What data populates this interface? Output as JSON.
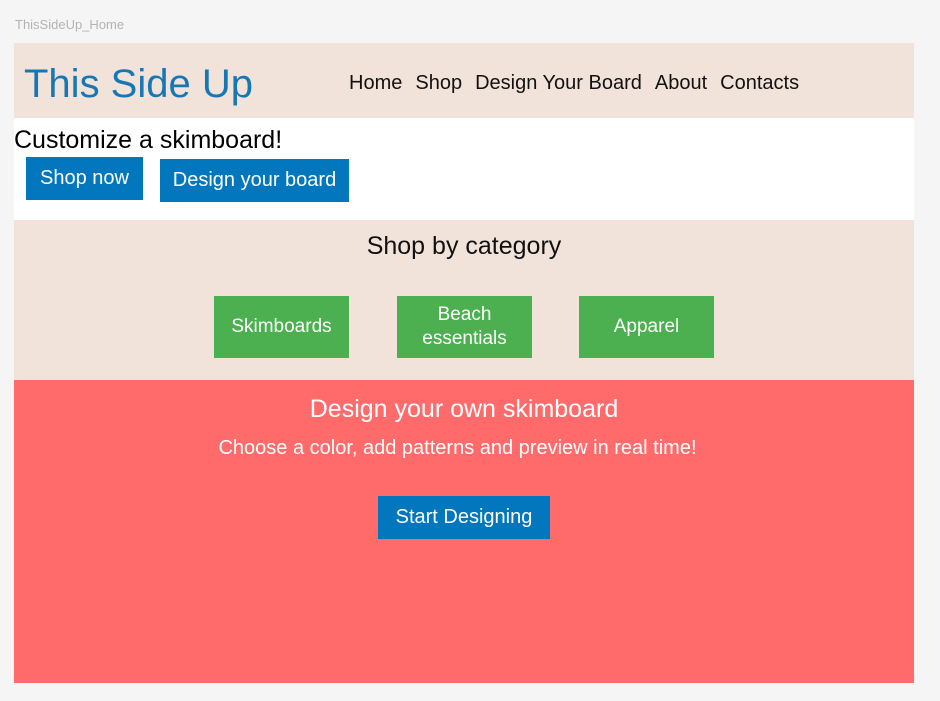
{
  "frame_label": "ThisSideUp_Home",
  "header": {
    "logo": "This Side Up",
    "nav": [
      "Home",
      "Shop",
      "Design Your Board",
      "About",
      "Contacts"
    ]
  },
  "hero": {
    "title": "Customize a skimboard!",
    "shop_now": "Shop now",
    "design_board": "Design your board"
  },
  "category": {
    "title": "Shop by category",
    "items": [
      "Skimboards",
      "Beach essentials",
      "Apparel"
    ]
  },
  "design": {
    "title": "Design your own skimboard",
    "subtitle": "Choose a color, add patterns and preview in real time!",
    "button": "Start Designing"
  },
  "colors": {
    "header_bg": "#f2e3da",
    "logo": "#1677b5",
    "blue_button": "#0277bd",
    "green_button": "#4caf50",
    "design_bg": "#ff6b6b"
  }
}
